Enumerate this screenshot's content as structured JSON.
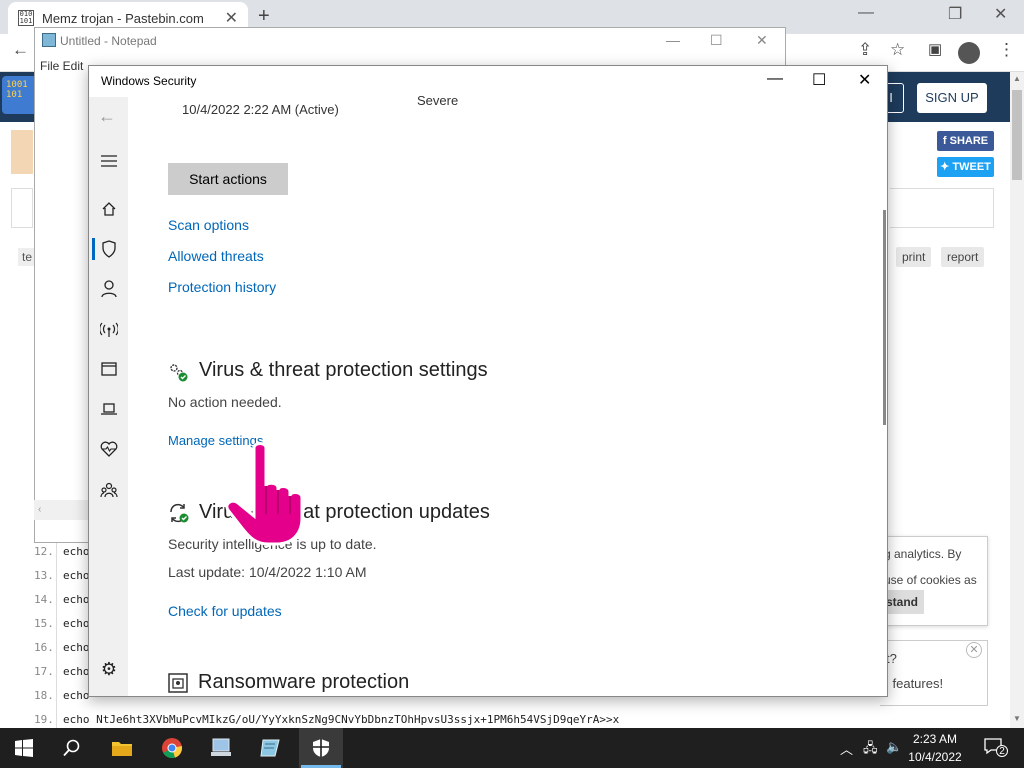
{
  "browser": {
    "tab_title": "Memz trojan - Pastebin.com",
    "tab_favicon_text": "010 101",
    "close_tab": "✕",
    "new_tab": "+"
  },
  "pastebin": {
    "logo_text": "1001 101",
    "login_partial": "I",
    "signup": "SIGN UP",
    "share": "SHARE",
    "tweet": "TWEET",
    "print": "print",
    "report": "report",
    "left_tag_partial": "te",
    "cookie_line1": "g analytics. By",
    "cookie_line2": "use of cookies as",
    "cookie_button": "stand",
    "pwa_line1": "t?",
    "pwa_line2": "l features!",
    "code_lines": [
      {
        "num": "12.",
        "text": "echo"
      },
      {
        "num": "13.",
        "text": "echo"
      },
      {
        "num": "14.",
        "text": "echo"
      },
      {
        "num": "15.",
        "text": "echo"
      },
      {
        "num": "16.",
        "text": "echo"
      },
      {
        "num": "17.",
        "text": "echo"
      },
      {
        "num": "18.",
        "text": "echo"
      },
      {
        "num": "19.",
        "text": "echo NtJe6ht3XVbMuPcvMIkzG/oU/YyYxknSzNg9CNvYbDbnzTOhHpvsU3ssjx+1PM6h54VSjD9qeYrA>>x"
      }
    ]
  },
  "notepad": {
    "title": "Untitled - Notepad",
    "menu": "File   Edit",
    "hscroll": "‹"
  },
  "windows_security": {
    "title": "Windows Security",
    "threat_time": "10/4/2022 2:22 AM (Active)",
    "threat_severity": "Severe",
    "start_actions": "Start actions",
    "links": {
      "scan_options": "Scan options",
      "allowed_threats": "Allowed threats",
      "protection_history": "Protection history"
    },
    "settings_section": {
      "heading": "Virus & threat protection settings",
      "status": "No action needed.",
      "link": "Manage settings"
    },
    "updates_section": {
      "heading": "Virus & threat protection updates",
      "status": "Security intelligence is up to date.",
      "last_update": "Last update: 10/4/2022 1:10 AM",
      "link": "Check for updates"
    },
    "ransomware_section": {
      "heading": "Ransomware protection"
    }
  },
  "taskbar": {
    "time": "2:23 AM",
    "date": "10/4/2022",
    "notification_count": "2"
  },
  "colors": {
    "link": "#0067b8",
    "pastebin_header": "#1e3b5c",
    "taskbar": "#1f1f1f",
    "cursor": "#e5008c"
  }
}
